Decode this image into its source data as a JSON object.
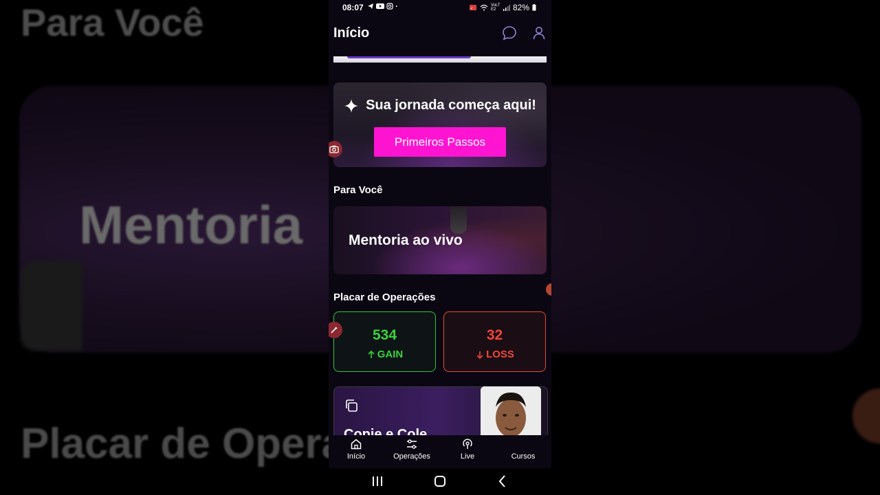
{
  "background": {
    "texts": [
      "Para Você",
      "Mentoria",
      "Placar de Operaç"
    ]
  },
  "status_bar": {
    "time": "08:07",
    "network_label": "VoLTE2",
    "battery": "82%"
  },
  "header": {
    "title": "Início"
  },
  "journey": {
    "title": "Sua jornada começa aqui!",
    "button": "Primeiros Passos"
  },
  "for_you": {
    "title": "Para Você",
    "card_title": "Mentoria ao vivo"
  },
  "scoreboard": {
    "title": "Placar de Operações",
    "gain": {
      "value": "534",
      "label": "GAIN",
      "color": "#3ad13f"
    },
    "loss": {
      "value": "32",
      "label": "LOSS",
      "color": "#f0463a"
    }
  },
  "copy_card": {
    "title": "Copie e Cole"
  },
  "bottom_nav": {
    "items": [
      {
        "label": "Início",
        "icon": "home-icon"
      },
      {
        "label": "Operações",
        "icon": "sliders-icon"
      },
      {
        "label": "Live",
        "icon": "broadcast-icon"
      },
      {
        "label": "Cursos",
        "icon": "book-icon"
      }
    ]
  },
  "colors": {
    "accent": "#ff14d2",
    "app_bg": "#0b0712",
    "header_icon": "#8f86d8"
  }
}
